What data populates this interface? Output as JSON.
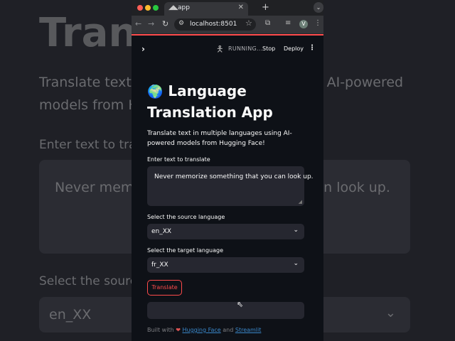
{
  "background": {
    "title": "Trans",
    "description": "Translate text in multiple languages using AI-powered models from Hugging Face!",
    "text_label": "Enter text to translate",
    "text_value": "Never memorize something that you can look up.",
    "source_label": "Select the source language",
    "source_value": "en_XX"
  },
  "browser": {
    "tab_title": "app",
    "url": "localhost:8501",
    "avatar": "V",
    "colors": {
      "close": "#ff5f57",
      "minimize": "#febc2e",
      "zoom": "#28c840"
    }
  },
  "header": {
    "sidebar_toggle": "›",
    "status": "RUNNING...",
    "stop": "Stop",
    "deploy": "Deploy",
    "menu": "⋮"
  },
  "app": {
    "globe": "🌍",
    "title": "Language Translation App",
    "description": "Translate text in multiple languages using AI-powered models from Hugging Face!",
    "text_label": "Enter text to translate",
    "text_value": "Never memorize something that you can look up.",
    "source_label": "Select the source language",
    "source_value": "en_XX",
    "target_label": "Select the target language",
    "target_value": "fr_XX",
    "translate_button": "Translate",
    "output_value": "",
    "footer_prefix": "Built with",
    "footer_heart": "❤",
    "footer_link1": "Hugging Face",
    "footer_and": "and",
    "footer_link2": "Streamlit",
    "accent": "#ff4b4b"
  }
}
